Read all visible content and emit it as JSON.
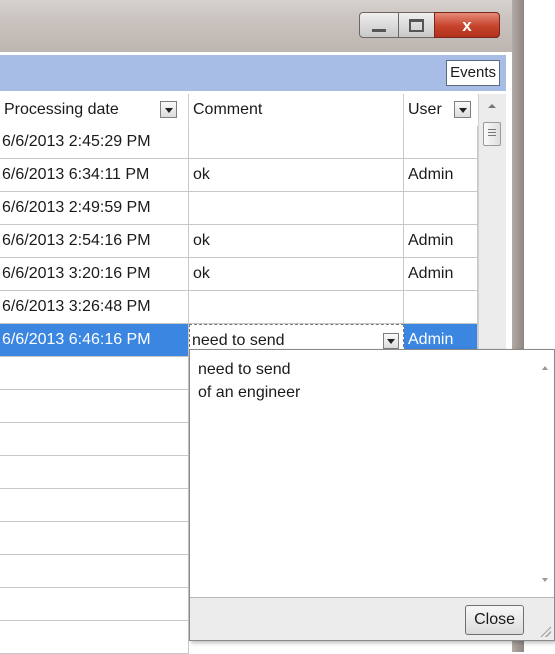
{
  "window": {
    "controls": {
      "minimize_icon": "minimize-icon",
      "maximize_icon": "maximize-icon",
      "close_icon": "close-icon",
      "close_glyph": "x"
    },
    "accent_color": "#a7bde6",
    "selection_color": "#3b86e0"
  },
  "toolbar": {
    "events_label": "Events"
  },
  "grid": {
    "columns": [
      {
        "label": "Processing date",
        "has_filter": true
      },
      {
        "label": "Comment",
        "has_filter": false
      },
      {
        "label": "User",
        "has_filter": true
      }
    ],
    "rows": [
      {
        "date": "6/6/2013 2:45:29 PM",
        "comment": "",
        "user": ""
      },
      {
        "date": "6/6/2013 6:34:11 PM",
        "comment": "ok",
        "user": "Admin"
      },
      {
        "date": "6/6/2013 2:49:59 PM",
        "comment": "",
        "user": ""
      },
      {
        "date": "6/6/2013 2:54:16 PM",
        "comment": "ok",
        "user": "Admin"
      },
      {
        "date": "6/6/2013 3:20:16 PM",
        "comment": "ok",
        "user": "Admin"
      },
      {
        "date": "6/6/2013 3:26:48 PM",
        "comment": "",
        "user": ""
      },
      {
        "date": "6/6/2013 6:46:16 PM",
        "comment": "need to send",
        "user": "Admin",
        "selected": true
      }
    ]
  },
  "comment_popup": {
    "text": "need to send\nof an engineer",
    "close_label": "Close"
  }
}
